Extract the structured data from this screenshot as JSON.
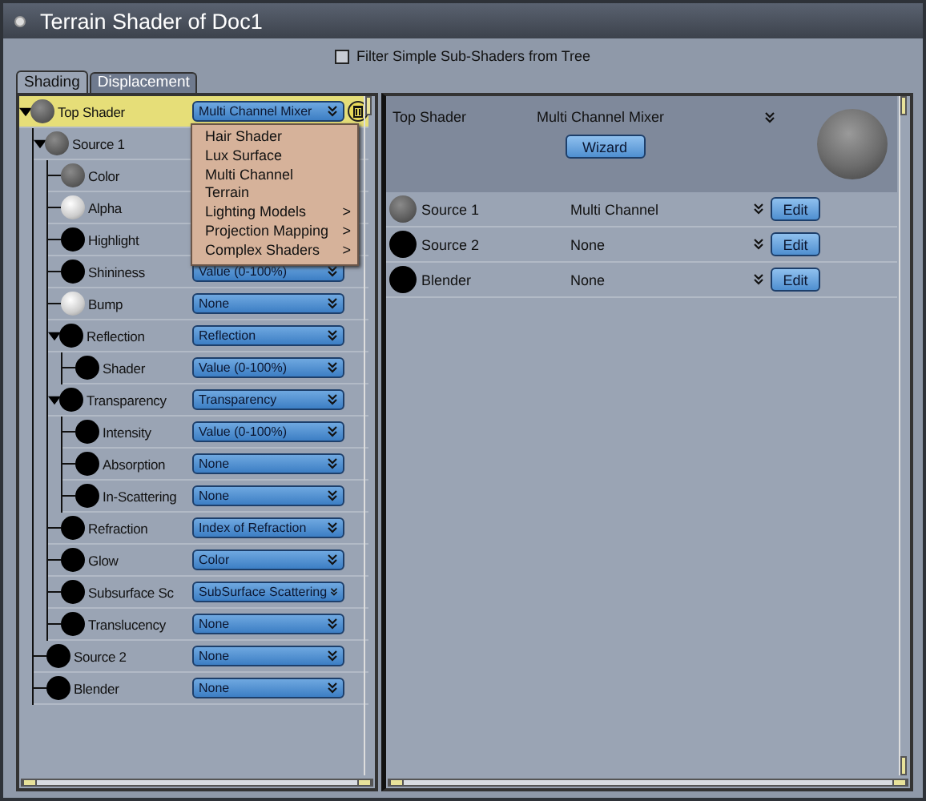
{
  "window": {
    "title": "Terrain Shader of Doc1"
  },
  "filter": {
    "label": "Filter Simple Sub-Shaders from Tree",
    "checked": false
  },
  "tabs": [
    {
      "label": "Shading",
      "selected": true
    },
    {
      "label": "Displacement",
      "selected": false
    }
  ],
  "tree": [
    {
      "label": "Top Shader",
      "kind": "gray",
      "value": "Multi Channel Mixer",
      "selected": true,
      "deletable": true,
      "expanded": true,
      "children": [
        {
          "label": "Source 1",
          "kind": "gray",
          "selected": false,
          "expanded": true,
          "children": [
            {
              "label": "Color",
              "kind": "gray",
              "selected": false
            },
            {
              "label": "Alpha",
              "kind": "white",
              "selected": false
            },
            {
              "label": "Highlight",
              "kind": "black",
              "selected": false
            },
            {
              "label": "Shininess",
              "kind": "black",
              "value": "Value (0-100%)",
              "selected": false
            },
            {
              "label": "Bump",
              "kind": "white",
              "value": "None",
              "selected": false
            },
            {
              "label": "Reflection",
              "kind": "black",
              "value": "Reflection",
              "selected": false,
              "expanded": true,
              "children": [
                {
                  "label": "Shader",
                  "kind": "black",
                  "value": "Value (0-100%)",
                  "selected": false
                }
              ]
            },
            {
              "label": "Transparency",
              "kind": "black",
              "value": "Transparency",
              "selected": false,
              "expanded": true,
              "children": [
                {
                  "label": "Intensity",
                  "kind": "black",
                  "value": "Value (0-100%)",
                  "selected": false
                },
                {
                  "label": "Absorption",
                  "kind": "black",
                  "value": "None",
                  "selected": false
                },
                {
                  "label": "In-Scattering",
                  "kind": "black",
                  "value": "None",
                  "selected": false
                }
              ]
            },
            {
              "label": "Refraction",
              "kind": "black",
              "value": "Index of Refraction",
              "selected": false
            },
            {
              "label": "Glow",
              "kind": "black",
              "value": "Color",
              "selected": false
            },
            {
              "label": "Subsurface Sc",
              "kind": "black",
              "value": "SubSurface Scattering",
              "selected": false
            },
            {
              "label": "Translucency",
              "kind": "black",
              "value": "None",
              "selected": false
            }
          ]
        },
        {
          "label": "Source 2",
          "kind": "black",
          "value": "None",
          "selected": false
        },
        {
          "label": "Blender",
          "kind": "black",
          "value": "None",
          "selected": false
        }
      ]
    }
  ],
  "menu": [
    {
      "label": "Hair Shader"
    },
    {
      "label": "Lux Surface"
    },
    {
      "label": "Multi Channel"
    },
    {
      "label": "Terrain"
    },
    {
      "label": "Lighting Models",
      "submenu_mark": ">"
    },
    {
      "label": "Projection Mapping",
      "submenu_mark": ">"
    },
    {
      "label": "Complex Shaders",
      "submenu_mark": ">"
    }
  ],
  "detail": {
    "label": "Top Shader",
    "value": "Multi Channel Mixer",
    "button": "Wizard",
    "rows": [
      {
        "label": "Source 1",
        "kind": "gray",
        "value": "Multi Channel",
        "button": "Edit"
      },
      {
        "label": "Source 2",
        "kind": "black",
        "value": "None",
        "button": "Edit"
      },
      {
        "label": "Blender",
        "kind": "black",
        "value": "None",
        "button": "Edit"
      }
    ]
  }
}
